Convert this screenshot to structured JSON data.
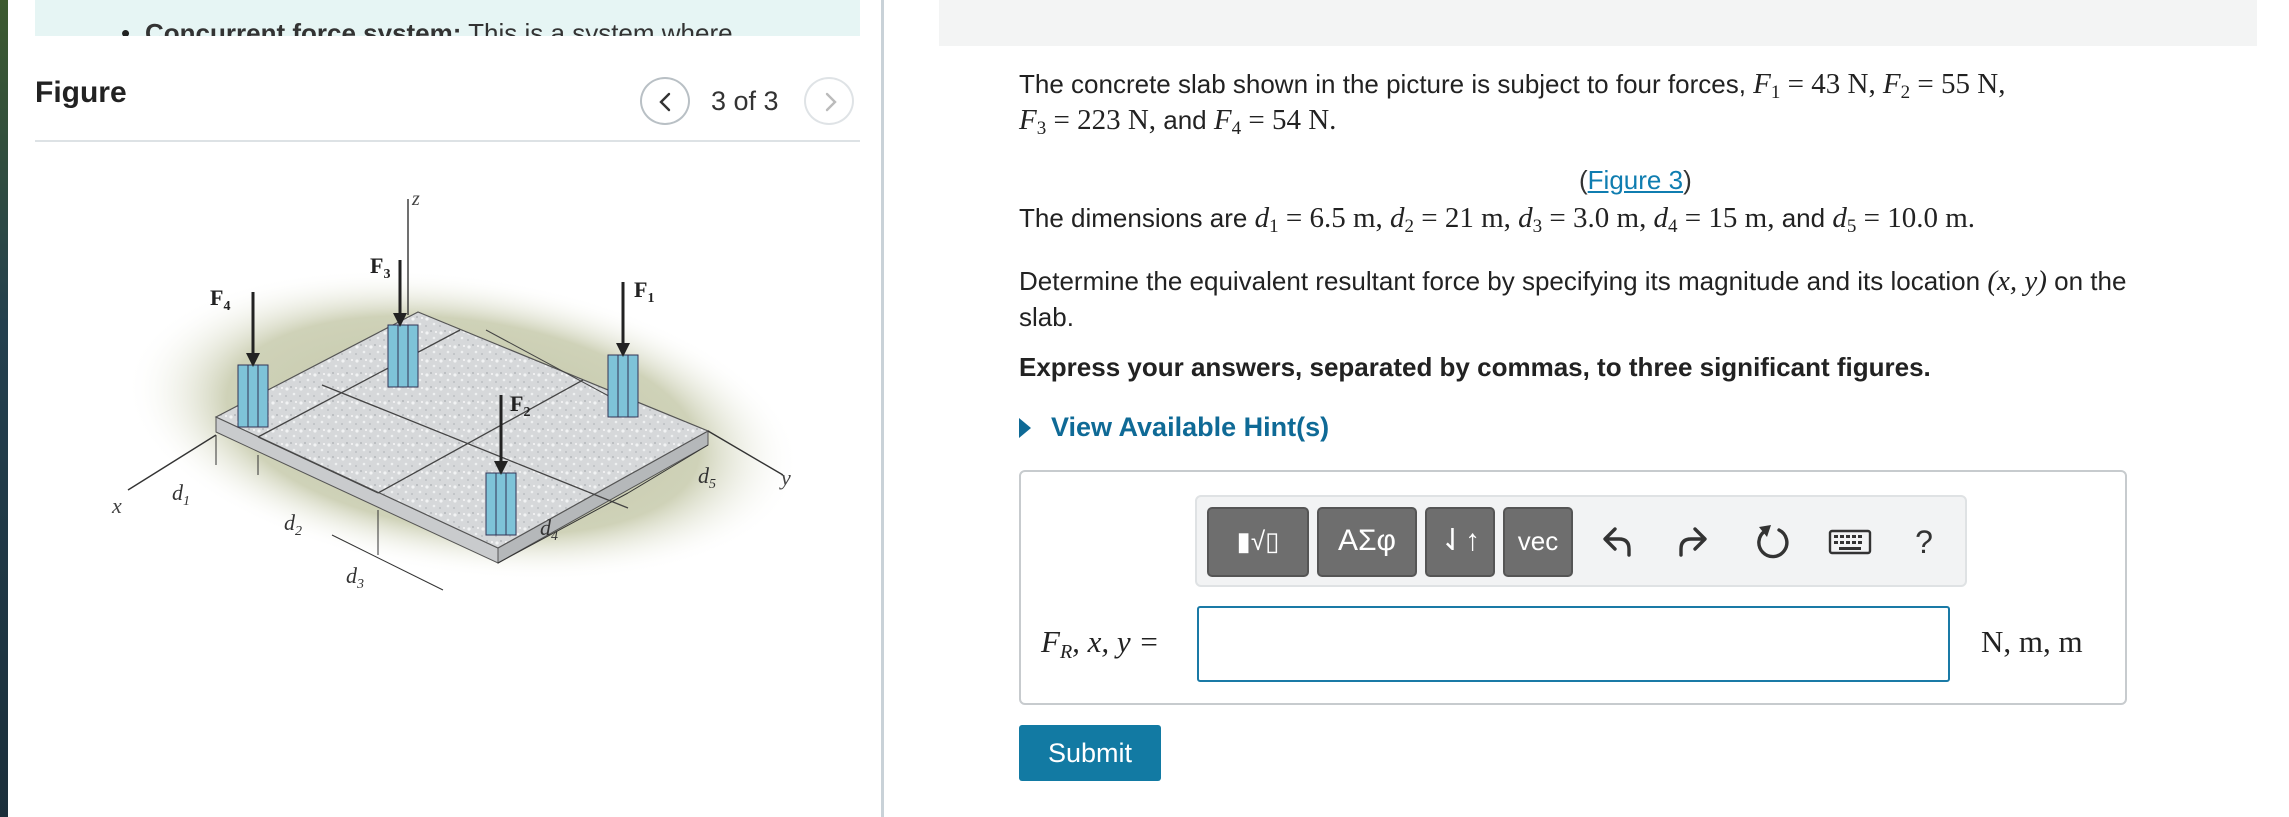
{
  "left_panel": {
    "note_text_bold": "Concurrent force system:",
    "note_text_rest": " This is a system where",
    "figure_title": "Figure",
    "pager_text": "3 of 3",
    "figure_labels": {
      "z": "z",
      "x": "x",
      "y": "y",
      "F1": "F",
      "F1_sub": "1",
      "F2": "F",
      "F2_sub": "2",
      "F3": "F",
      "F3_sub": "3",
      "F4": "F",
      "F4_sub": "4",
      "d1": "d",
      "d1_sub": "1",
      "d2": "d",
      "d2_sub": "2",
      "d3": "d",
      "d3_sub": "3",
      "d4": "d",
      "d4_sub": "4",
      "d5": "d",
      "d5_sub": "5"
    }
  },
  "question": {
    "intro": "The concrete slab shown in the picture is subject to four forces,",
    "F1_value": "43 N",
    "F2_value": "55 N",
    "F3_value": "223 N",
    "F4_value": "54 N",
    "and": "and",
    "figure_link": "Figure 3",
    "dims_intro": "The dimensions are",
    "d1_value": "6.5 m",
    "d2_value": "21 m",
    "d3_value": "3.0 m",
    "d4_value": "15 m",
    "d5_value": "10.0 m",
    "determine_1": "Determine the equivalent resultant force by specifying its magnitude and its location",
    "determine_loc": "(x, y)",
    "determine_on": "on the",
    "determine_2": "slab.",
    "instruction": "Express your answers, separated by commas, to three significant figures.",
    "hint_label": "View Available Hint(s)"
  },
  "answer": {
    "toolbar": {
      "templates_label": "▮√▯",
      "greek_label": "ΑΣφ",
      "arrows_label": "⇃↑",
      "vec_label": "vec",
      "help_label": "?"
    },
    "label_F": "F",
    "label_R": "R",
    "label_rest": ", x, y =",
    "input_value": "",
    "units": "N, m, m"
  },
  "submit_label": "Submit",
  "colors": {
    "accent": "#127aa3",
    "link": "#0f7db0",
    "note_bg": "#e6f5f4",
    "column": "#7ec3d8"
  }
}
